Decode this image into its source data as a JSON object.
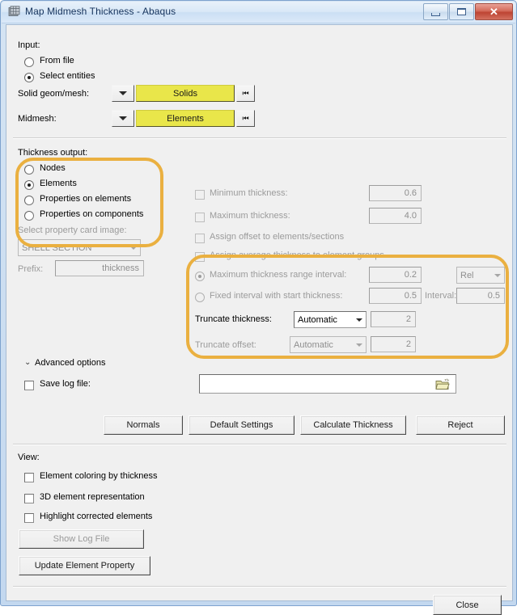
{
  "window": {
    "title": "Map Midmesh Thickness - Abaqus",
    "icon": "app-window-icon",
    "minimize_label": "",
    "maximize_label": "",
    "close_label": "✕"
  },
  "input": {
    "group_label": "Input:",
    "options": [
      {
        "label": "From file",
        "selected": false
      },
      {
        "label": "Select entities",
        "selected": true
      }
    ],
    "solid_geom": {
      "label": "Solid geom/mesh:",
      "selector_value": "Solids",
      "dropdown_icon": "chevron-down-icon",
      "reset_icon": "⏮"
    },
    "midmesh": {
      "label": "Midmesh:",
      "selector_value": "Elements",
      "dropdown_icon": "chevron-down-icon",
      "reset_icon": "⏮"
    }
  },
  "thickness_output": {
    "group_label": "Thickness output:",
    "options": [
      {
        "label": "Nodes",
        "selected": false
      },
      {
        "label": "Elements",
        "selected": true
      },
      {
        "label": "Properties on elements",
        "selected": false
      },
      {
        "label": "Properties on components",
        "selected": false
      }
    ],
    "card_image_label": "Select property card image:",
    "card_image_value": "SHELL SECTION",
    "prefix_label": "Prefix:",
    "prefix_value": "thickness"
  },
  "limits": {
    "minimum_thickness": {
      "label": "Minimum thickness:",
      "checked": false,
      "value": "0.6",
      "enabled": false
    },
    "maximum_thickness": {
      "label": "Maximum thickness:",
      "checked": false,
      "value": "4.0",
      "enabled": false
    },
    "assign_offset": {
      "label": "Assign offset to elements/sections",
      "checked": false
    },
    "assign_average": {
      "label": "Assign average thickness to element groups",
      "checked": false
    }
  },
  "interval": {
    "max_range": {
      "label": "Maximum thickness range interval:",
      "selected": true,
      "enabled": false,
      "value": "0.2",
      "unit_value": "Rel"
    },
    "fixed_interval": {
      "label": "Fixed interval with start thickness:",
      "selected": false,
      "enabled": false,
      "value": "0.5",
      "interval_label": "Interval:",
      "interval_value": "0.5"
    },
    "truncate_thickness": {
      "label": "Truncate thickness:",
      "mode": "Automatic",
      "value": "2",
      "enabled": true
    },
    "truncate_offset": {
      "label": "Truncate offset:",
      "mode": "Automatic",
      "value": "2",
      "enabled": false
    }
  },
  "advanced": {
    "toggle_label": "Advanced options",
    "toggle_icon": "chevron-expand-icon",
    "save_log": {
      "label": "Save log file:",
      "checked": false,
      "path_value": "",
      "browse_icon": "folder-open-icon"
    }
  },
  "actions": {
    "normals": "Normals",
    "default_settings": "Default Settings",
    "calculate_thickness": "Calculate Thickness",
    "reject": "Reject"
  },
  "view": {
    "group_label": "View:",
    "options": [
      {
        "label": "Element coloring by thickness",
        "checked": false
      },
      {
        "label": "3D element representation",
        "checked": false
      },
      {
        "label": "Highlight corrected elements",
        "checked": false
      }
    ],
    "show_log_file": {
      "label": "Show Log File",
      "enabled": false
    },
    "update_element_property": {
      "label": "Update Element Property",
      "enabled": true
    }
  },
  "footer": {
    "close_label": "Close"
  },
  "colors": {
    "highlight": "#eab040",
    "selector_yellow": "#e9e64a",
    "title_text": "#15335c",
    "close_button": "#bd4433"
  }
}
